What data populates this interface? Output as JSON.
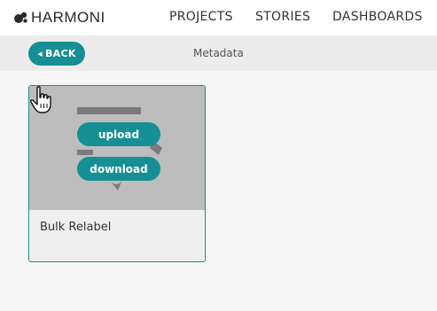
{
  "header": {
    "brand": "HARMONI",
    "nav": [
      "PROJECTS",
      "STORIES",
      "DASHBOARDS"
    ]
  },
  "subbar": {
    "back_label": "BACK",
    "title": "Metadata"
  },
  "card": {
    "title": "Bulk Relabel",
    "upload_label": "upload",
    "download_label": "download"
  },
  "colors": {
    "accent": "#158f94",
    "thumb_bg": "#bdbdbd"
  }
}
